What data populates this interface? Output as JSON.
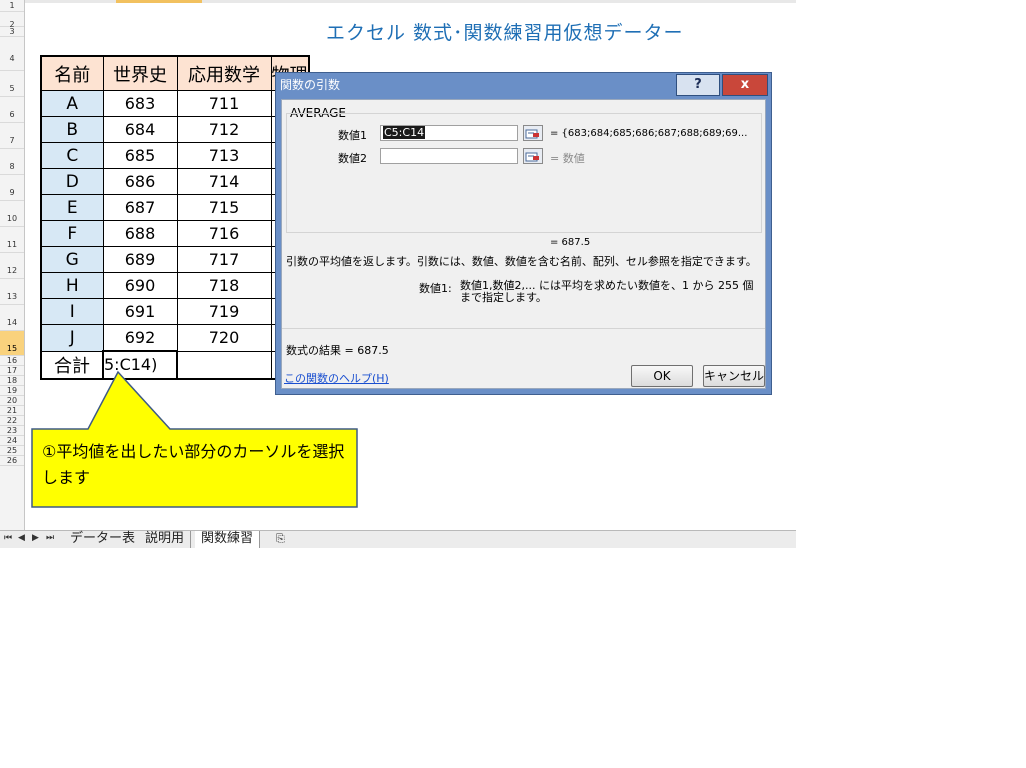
{
  "title": "エクセル 数式･関数練習用仮想データー",
  "row_numbers": [
    "1",
    "2",
    "3",
    "4",
    "5",
    "6",
    "7",
    "8",
    "9",
    "10",
    "11",
    "12",
    "13",
    "14",
    "15",
    "16",
    "17",
    "18",
    "19",
    "20",
    "21",
    "22",
    "23",
    "24",
    "25",
    "26"
  ],
  "table": {
    "headers": [
      "名前",
      "世界史",
      "応用数学",
      "物理"
    ],
    "rows": [
      [
        "A",
        "683",
        "711"
      ],
      [
        "B",
        "684",
        "712"
      ],
      [
        "C",
        "685",
        "713"
      ],
      [
        "D",
        "686",
        "714"
      ],
      [
        "E",
        "687",
        "715"
      ],
      [
        "F",
        "688",
        "716"
      ],
      [
        "G",
        "689",
        "717"
      ],
      [
        "H",
        "690",
        "718"
      ],
      [
        "I",
        "691",
        "719"
      ],
      [
        "J",
        "692",
        "720"
      ]
    ],
    "total_label": "合計",
    "total_formula": "5:C14)"
  },
  "callout": {
    "text": "①平均値を出したい部分のカーソルを選択します",
    "fill": "#ffff00",
    "border": "#3e5a85"
  },
  "sheet_tabs": [
    "データー表",
    "説明用",
    "関数練習"
  ],
  "active_tab": 2,
  "dialog": {
    "title": "関数の引数",
    "help_button": "?",
    "close_button": "x",
    "function_name": "AVERAGE",
    "arg1_label": "数値1",
    "arg1_value": "C5:C14",
    "arg1_result": "= {683;684;685;686;687;688;689;69...",
    "arg2_label": "数値2",
    "arg2_value": "",
    "arg2_result": "= 数値",
    "formula_value": "= 687.5",
    "description": "引数の平均値を返します。引数には、数値、数値を含む名前、配列、セル参照を指定できます。",
    "arg_desc_label": "数値1:",
    "arg_desc_text": "数値1,数値2,... には平均を求めたい数値を、1 から 255 個まで指定します。",
    "result_label": "数式の結果 = ",
    "result_value": "687.5",
    "help_link": "この関数のヘルプ(H)",
    "ok_label": "OK",
    "cancel_label": "キャンセル"
  },
  "colors": {
    "title": "#1f6fb5",
    "header_fill": "#fde3d2",
    "name_fill": "#d7e8f5",
    "dialog_frame": "#6a8fc7",
    "close_button": "#c9473a",
    "selected_row": "#f9d27d"
  },
  "icons": [
    "ref-collapse-icon",
    "help-icon",
    "close-icon",
    "new-sheet-icon"
  ]
}
